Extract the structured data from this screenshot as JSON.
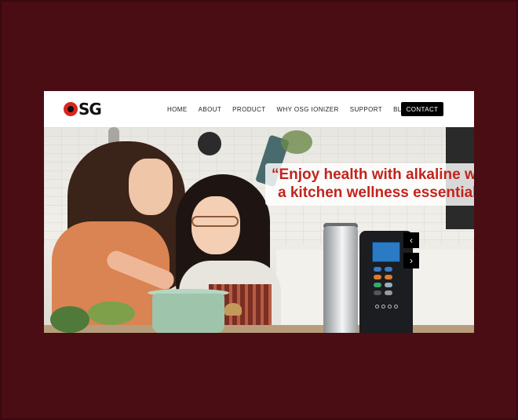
{
  "header": {
    "logo_text": "SG",
    "nav": [
      "HOME",
      "ABOUT",
      "PRODUCT",
      "WHY OSG IONIZER",
      "SUPPORT",
      "BLOGS"
    ],
    "contact_label": "CONTACT"
  },
  "hero": {
    "quote_line1": "“Enjoy health with alkaline wa",
    "quote_line2": "a kitchen wellness essential.”",
    "prev_arrow": "‹",
    "next_arrow": "›"
  },
  "colors": {
    "page_background": "#4a0d14",
    "brand_red": "#d7261e",
    "quote_red": "#c2241c",
    "contact_button": "#000000"
  },
  "icons": [
    "chevron-left-icon",
    "chevron-right-icon"
  ]
}
